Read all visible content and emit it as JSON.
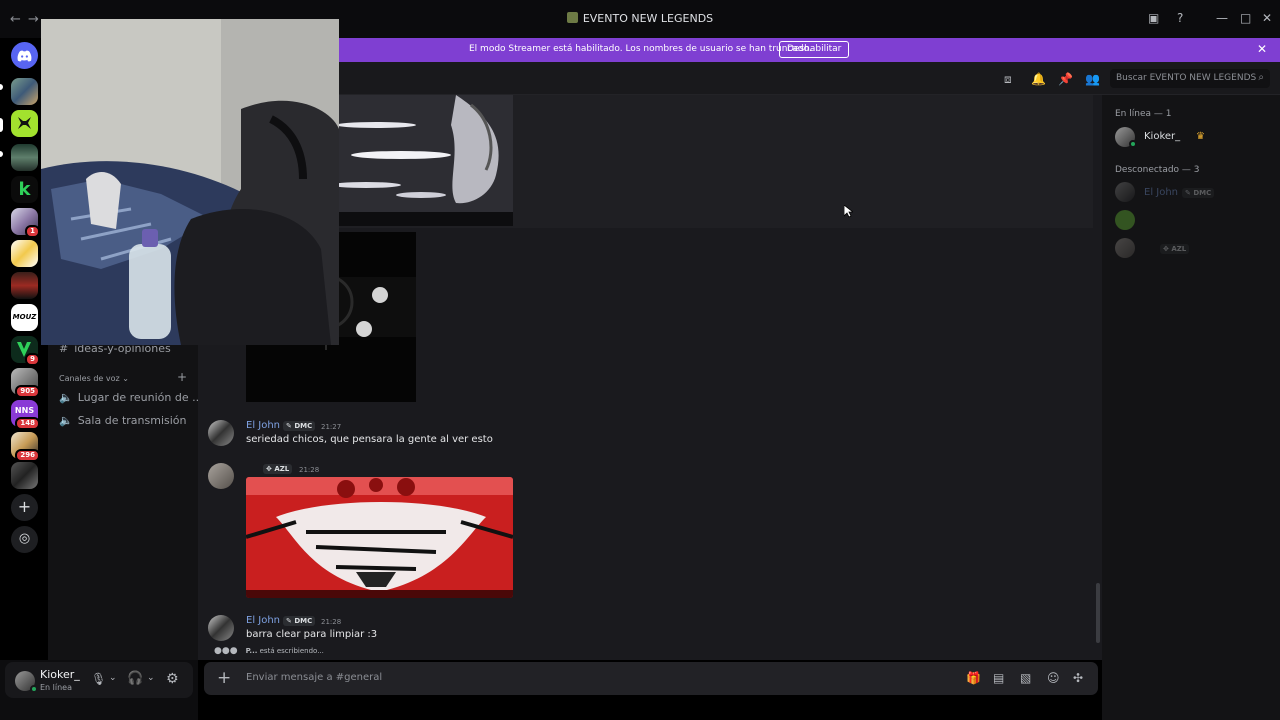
{
  "window": {
    "title": "EVENTO NEW LEGENDS"
  },
  "banner": {
    "message": "El modo Streamer está habilitado. Los nombres de usuario se han truncado.",
    "button": "Deshabilitar"
  },
  "servers": [
    {
      "name": "server-1",
      "badge": ""
    },
    {
      "name": "server-2",
      "badge": ""
    },
    {
      "name": "server-3",
      "badge": ""
    },
    {
      "name": "server-4",
      "badge": ""
    },
    {
      "name": "server-5",
      "badge": "1"
    },
    {
      "name": "server-6",
      "badge": ""
    },
    {
      "name": "server-7",
      "badge": ""
    },
    {
      "name": "server-8",
      "badge": ""
    },
    {
      "name": "server-9",
      "badge": "9"
    },
    {
      "name": "server-10",
      "badge": "905"
    },
    {
      "name": "server-11",
      "badge": "148"
    },
    {
      "name": "server-12",
      "badge": "296"
    },
    {
      "name": "server-13",
      "badge": ""
    }
  ],
  "server_labels": {
    "mouz": "MOUZ",
    "nns": "NNS"
  },
  "channels": {
    "text_partial": "ideas-y-opiniones",
    "voice_category": "Canales de voz",
    "voice": [
      "Lugar de reunión de ...",
      "Sala de transmisión"
    ]
  },
  "user": {
    "name": "Kioker_",
    "status": "En línea"
  },
  "search": {
    "placeholder": "Buscar EVENTO NEW LEGENDS"
  },
  "messages": [
    {
      "author": "El John",
      "tag": "DMC",
      "time": "21:27",
      "text": "seriedad chicos, que pensara la gente al ver esto"
    },
    {
      "author": "",
      "tag": "AZL",
      "time": "21:28",
      "text": ""
    },
    {
      "author": "El John",
      "tag": "DMC",
      "time": "21:28",
      "text": "barra clear para limpiar :3"
    }
  ],
  "typing": {
    "user": "P...",
    "text": "está escribiendo..."
  },
  "composer": {
    "placeholder": "Enviar mensaje a #general"
  },
  "members": {
    "online_header": "En línea — 1",
    "online": [
      {
        "name": "Kioker_"
      }
    ],
    "offline_header": "Desconectado — 3",
    "offline": [
      {
        "name": "El John",
        "tag": "DMC"
      },
      {
        "name": "",
        "tag": ""
      },
      {
        "name": "",
        "tag": "AZL"
      }
    ]
  },
  "colors": {
    "banner": "#7f3fd2",
    "author": "#7ea1e2",
    "online": "#23a55a",
    "mention_badge": "#da373c"
  }
}
